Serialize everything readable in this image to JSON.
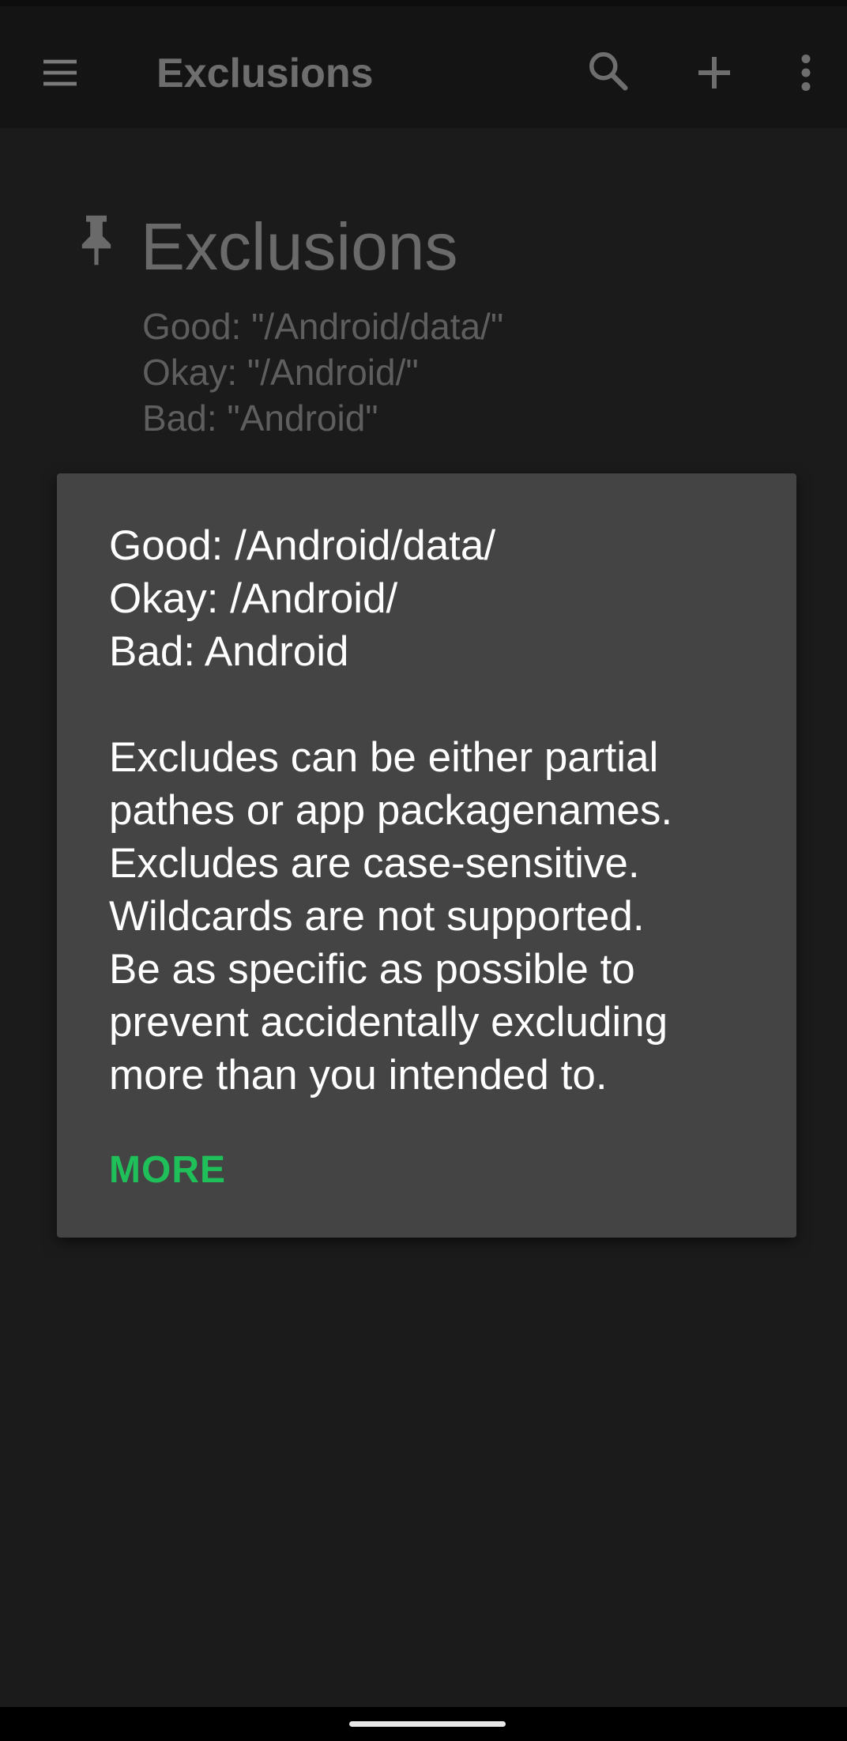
{
  "toolbar": {
    "title": "Exclusions"
  },
  "header": {
    "title": "Exclusions",
    "lines": [
      "Good: \"/Android/data/\"",
      "Okay: \"/Android/\"",
      "Bad: \"Android\""
    ]
  },
  "tooltip": {
    "examples": [
      "Good: /Android/data/",
      "Okay: /Android/",
      "Bad: Android"
    ],
    "body_lines": [
      "Excludes can be either partial",
      "pathes or app packagenames.",
      "Excludes are case-sensitive.",
      "Wildcards are not supported.",
      "Be as specific as possible to",
      "prevent accidentally excluding",
      "more than you intended to."
    ],
    "more_label": "MORE"
  },
  "colors": {
    "background": "#1b1b1b",
    "toolbar": "#141414",
    "tooltip": "#444444",
    "accent": "#1fc05a"
  },
  "icons": [
    "menu-icon",
    "search-icon",
    "add-icon",
    "more-vert-icon",
    "pin-icon"
  ]
}
